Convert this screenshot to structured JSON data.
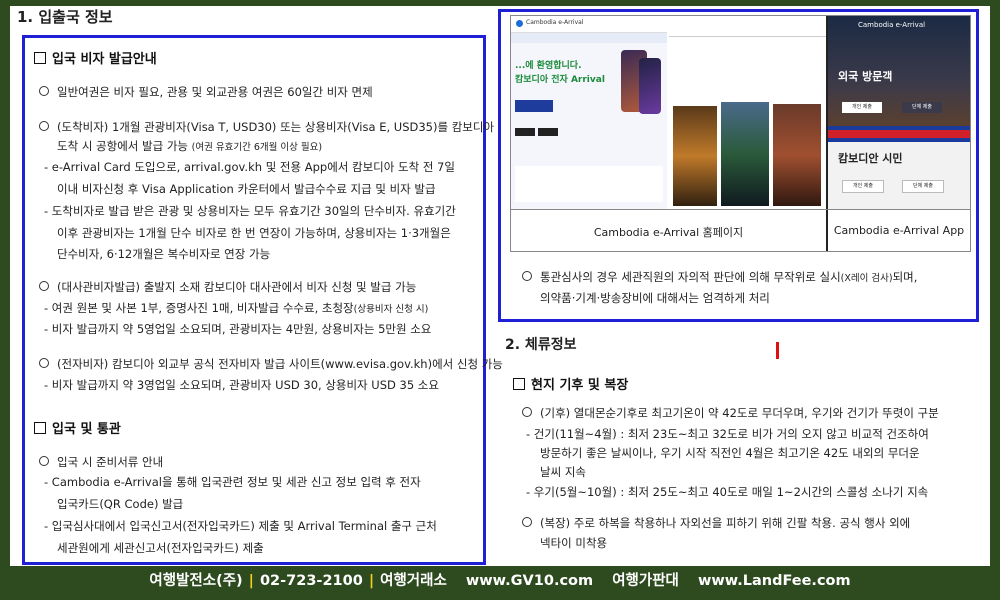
{
  "section1": {
    "title": "1. 입출국 정보"
  },
  "visa": {
    "title": "입국 비자 발급안내",
    "lines": [
      "일반여권은 비자 필요, 관용 및 외교관용 여권은 60일간 비자 면제",
      "(도착비자) 1개월 관광비자(Visa T, USD30) 또는 상용비자(Visa E, USD35)를 캄보디아",
      "도착 시 공항에서 발급 가능",
      "(여권 유효기간 6개월 이상 필요)",
      "- e-Arrival Card 도입으로, arrival.gov.kh 및 전용 App에서 캄보디아 도착 전 7일",
      "이내 비자신청 후 Visa Application 카운터에서 발급수수료 지급 및 비자 발급",
      "- 도착비자로 발급 받은 관광 및 상용비자는 모두 유효기간 30일의 단수비자. 유효기간",
      "이후 관광비자는 1개월 단수 비자로 한 번 연장이 가능하며, 상용비자는 1·3개월은",
      "단수비자, 6·12개월은 복수비자로 연장 가능",
      "(대사관비자발급) 출발지 소재 캄보디아 대사관에서 비자 신청 및 발급 가능",
      "- 여권 원본 및 사본 1부, 증명사진 1매, 비자발급 수수료, 초청장",
      "(상용비자 신청 시)",
      "- 비자 발급까지 약 5영업일 소요되며, 관광비자는 4만원, 상용비자는 5만원 소요",
      "(전자비자) 캄보디아 외교부 공식 전자비자 발급 사이트(www.evisa.gov.kh)에서 신청 가능",
      "- 비자 발급까지 약 3영업일 소요되며, 관광비자 USD 30, 상용비자 USD 35 소요"
    ]
  },
  "entry": {
    "title": "입국 및 통관",
    "lines": [
      "입국 시 준비서류 안내",
      "- Cambodia e-Arrival을 통해 입국관련 정보 및 세관 신고 정보 입력 후 전자",
      "입국카드(QR Code) 발급",
      "- 입국심사대에서 입국신고서(전자입국카드) 제출 및 Arrival Terminal 출구 근처",
      "세관원에게 세관신고서(전자입국카드) 제출"
    ]
  },
  "images": {
    "homepage_caption": "Cambodia e-Arrival 홈페이지",
    "app_caption": "Cambodia e-Arrival App",
    "site_title": "Cambodia e-Arrival",
    "welcome": "...에 환영합니다.",
    "arrival_title": "캄보디아 전자 Arrival",
    "foreign": "외국 방문객",
    "citizen": "캄보디안 시민",
    "btn1": "개인 제출",
    "btn2": "단체 제출"
  },
  "customs_note": {
    "lines": [
      "통관심사의 경우 세관직원의 자의적 판단에 의해 무작위로 실시",
      "(X레이 검사)",
      "되며,",
      "의약품·기계·방송장비에 대해서는 엄격하게 처리"
    ]
  },
  "section2": {
    "title": "2. 체류정보"
  },
  "climate": {
    "title": "현지 기후 및 복장",
    "lines": [
      "(기후) 열대몬순기후로 최고기온이 약 42도로 무더우며, 우기와 건기가 뚜렷이 구분",
      "- 건기(11월~4월) : 최저 23도~최고 32도로 비가 거의 오지 않고 비교적 건조하여",
      "방문하기 좋은 날씨이나, 우기 시작 직전인 4월은 최고기온 42도 내외의 무더운",
      "날씨 지속",
      "- 우기(5월~10월) : 최저 25도~최고 40도로 매일 1~2시간의 스콜성 소나기 지속",
      "(복장) 주로 하복을 착용하나 자외선을 피하기 위해 긴팔 착용. 공식 행사 외에",
      "넥타이 미착용"
    ]
  },
  "footer": {
    "company": "여행발전소(주)",
    "phone": "02-723-2100",
    "agency": "여행거래소",
    "site1": "www.GV10.com",
    "board": "여행가판대",
    "site2": "www.LandFee.com"
  },
  "colors": {
    "frame": "#2e4a1f",
    "box_border": "#1f1fd6",
    "footer_separator": "#f5d020"
  }
}
